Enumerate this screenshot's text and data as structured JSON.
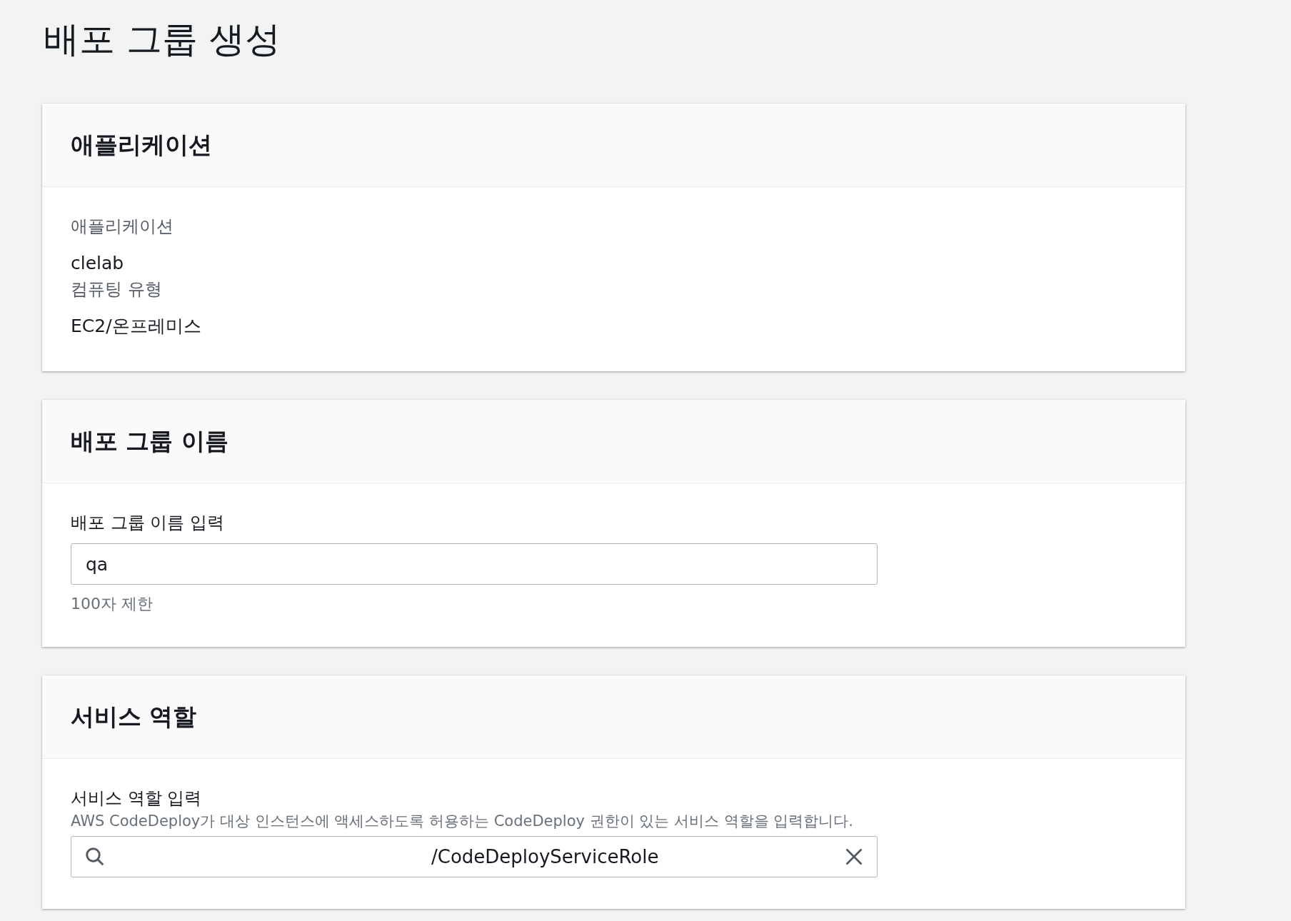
{
  "page_title": "배포 그룹 생성",
  "sections": [
    {
      "kind": "details",
      "heading": "애플리케이션",
      "fields": [
        {
          "label": "애플리케이션",
          "value": "clelab"
        },
        {
          "label": "컴퓨팅 유형",
          "value": "EC2/온프레미스"
        }
      ]
    },
    {
      "kind": "text_input",
      "heading": "배포 그룹 이름",
      "label": "배포 그룹 이름 입력",
      "value": "qa",
      "hint": "100자 제한"
    },
    {
      "kind": "search_input",
      "heading": "서비스 역할",
      "label": "서비스 역할 입력",
      "description": "AWS CodeDeploy가 대상 인스턴스에 액세스하도록 허용하는 CodeDeploy 권한이 있는 서비스 역할을 입력합니다.",
      "value": "/CodeDeployServiceRole"
    }
  ]
}
